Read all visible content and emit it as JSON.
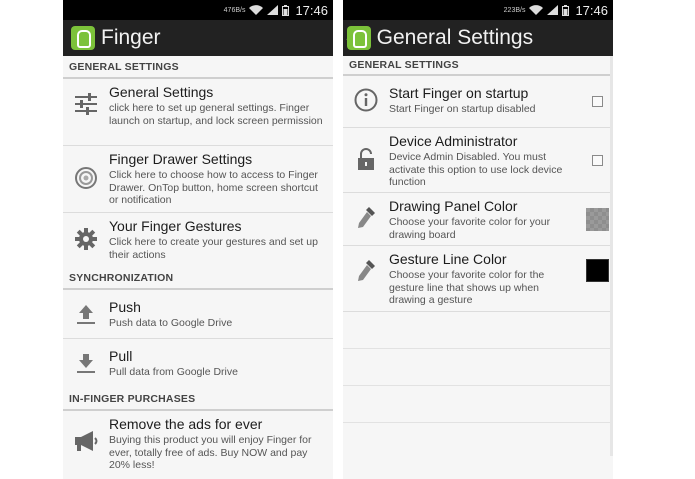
{
  "left": {
    "status": {
      "speed": "476B/s",
      "time": "17:46"
    },
    "app_title": "Finger",
    "sections": [
      {
        "header": "GENERAL SETTINGS"
      },
      {
        "header": "SYNCHRONIZATION"
      },
      {
        "header": "IN-FINGER PURCHASES"
      }
    ],
    "items": {
      "general": {
        "title": "General Settings",
        "subtitle": "click here to set up general settings. Finger launch on startup, and lock screen permission",
        "icon": "sliders-icon"
      },
      "drawer": {
        "title": "Finger Drawer Settings",
        "subtitle": "Click here to choose how to access to Finger Drawer. OnTop button, home screen shortcut or notification",
        "icon": "ring-icon"
      },
      "gestures": {
        "title": "Your Finger Gestures",
        "subtitle": "Click here to create your gestures and set up their actions",
        "icon": "gear-icon"
      },
      "push": {
        "title": "Push",
        "subtitle": "Push data to Google Drive",
        "icon": "upload-icon"
      },
      "pull": {
        "title": "Pull",
        "subtitle": "Pull data from Google Drive",
        "icon": "download-icon"
      },
      "remove_ads": {
        "title": "Remove the ads for ever",
        "subtitle": "Buying this product you will enjoy Finger for ever, totally free of ads. Buy NOW and pay 20% less!",
        "icon": "megaphone-icon"
      }
    }
  },
  "right": {
    "status": {
      "speed": "223B/s",
      "time": "17:46"
    },
    "app_title": "General Settings",
    "section_header": "GENERAL SETTINGS",
    "items": {
      "startup": {
        "title": "Start Finger on startup",
        "subtitle": "Start Finger on startup disabled",
        "icon": "info-icon",
        "checked": false
      },
      "admin": {
        "title": "Device Administrator",
        "subtitle": "Device Admin Disabled. You must activate this option to use lock device function",
        "icon": "lock-icon",
        "checked": false
      },
      "panel_color": {
        "title": "Drawing Panel Color",
        "subtitle": "Choose your favorite color for your drawing board",
        "icon": "eyedropper-icon",
        "color": "#9a9a9a"
      },
      "line_color": {
        "title": "Gesture Line Color",
        "subtitle": "Choose your favorite color for the gesture line that shows up when drawing a gesture",
        "icon": "eyedropper-icon",
        "color": "#000000"
      }
    }
  },
  "colors": {
    "actionbar": "#222222",
    "statusbar": "#000000",
    "logo": "#7cc23a"
  }
}
